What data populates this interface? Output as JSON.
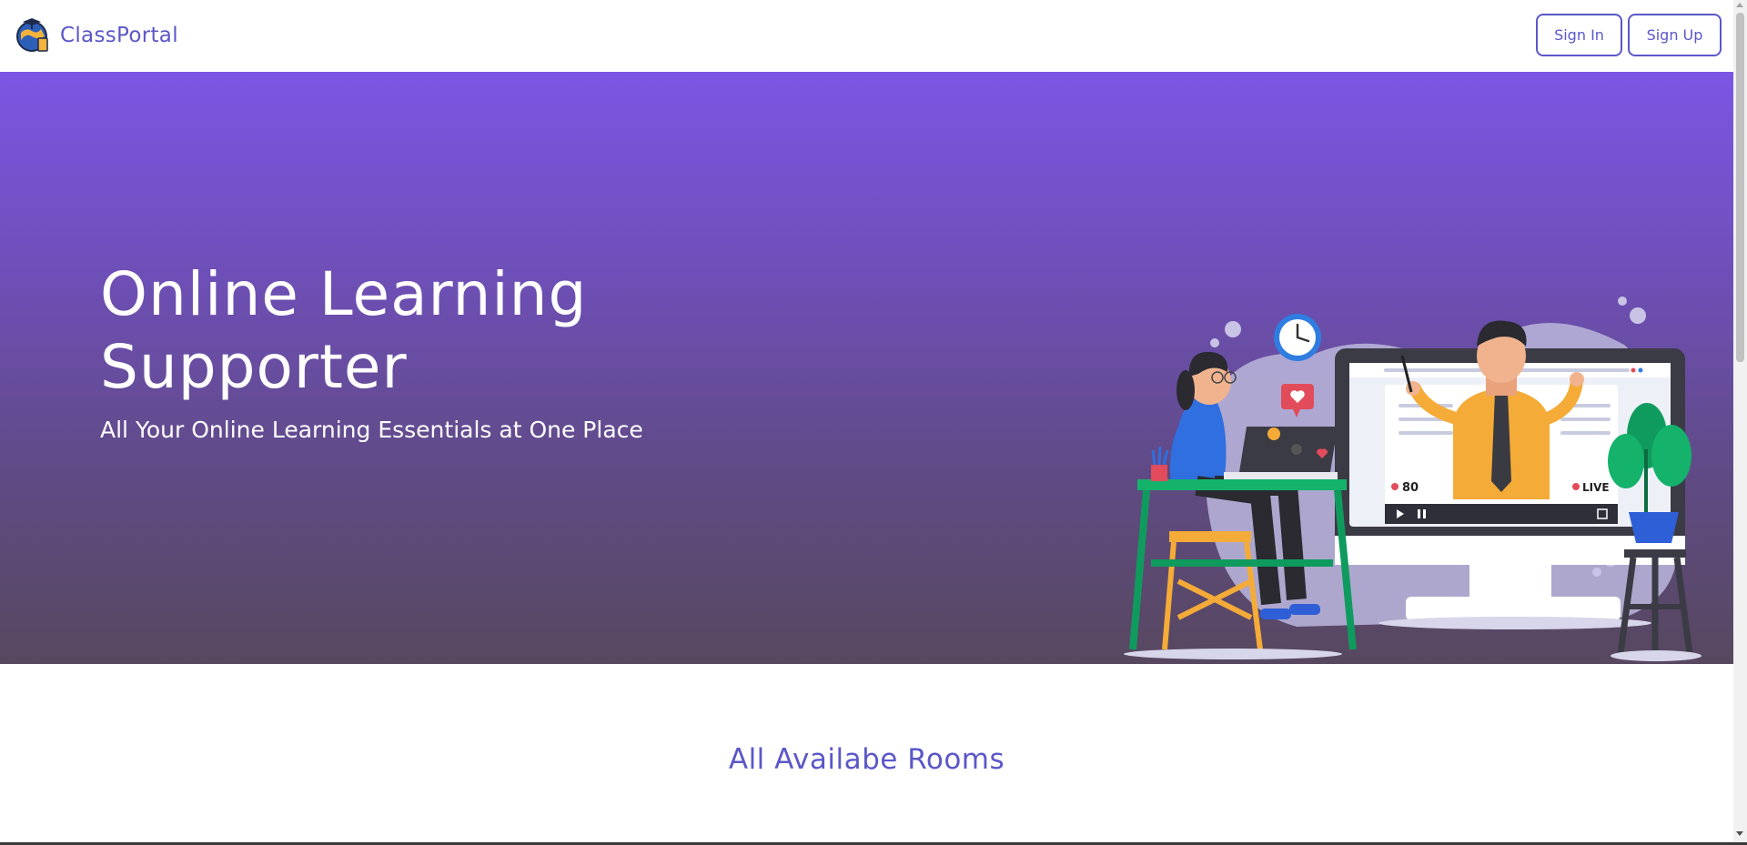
{
  "nav": {
    "brand": "ClassPortal",
    "signin_label": "Sign In",
    "signup_label": "Sign Up"
  },
  "hero": {
    "title": "Online Learning Supporter",
    "subtitle": "All Your Online Learning Essentials at One Place",
    "illustration": {
      "viewer_count": "80",
      "live_label": "LIVE"
    }
  },
  "rooms": {
    "title": "All Availabe Rooms"
  },
  "colors": {
    "accent": "#5b57c9",
    "hero_top": "#7b56e4",
    "hero_bottom": "#57485f"
  }
}
